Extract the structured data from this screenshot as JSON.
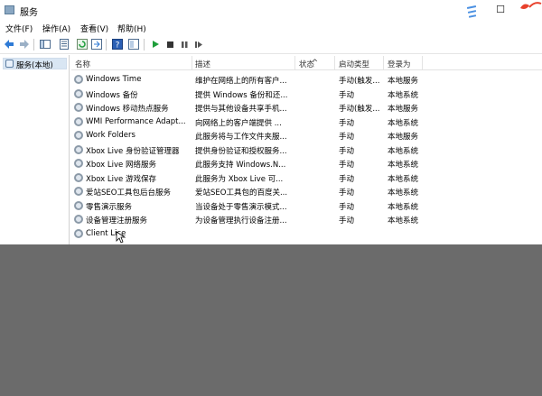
{
  "window": {
    "title": "服务"
  },
  "menu": [
    "文件(F)",
    "操作(A)",
    "查看(V)",
    "帮助(H)"
  ],
  "tree": {
    "root_label": "服务(本地)"
  },
  "columns": [
    "名称",
    "描述",
    "状态",
    "启动类型",
    "登录为"
  ],
  "rows": [
    {
      "name": "Windows Time",
      "desc": "维护在网络上的所有客户...",
      "status": "",
      "startup": "手动(触发...",
      "logon": "本地服务"
    },
    {
      "name": "Windows 备份",
      "desc": "提供 Windows 备份和还...",
      "status": "",
      "startup": "手动",
      "logon": "本地系统"
    },
    {
      "name": "Windows 移动热点服务",
      "desc": "提供与其他设备共享手机...",
      "status": "",
      "startup": "手动(触发...",
      "logon": "本地服务"
    },
    {
      "name": "WMI Performance Adapt...",
      "desc": "向网络上的客户端提供 ...",
      "status": "",
      "startup": "手动",
      "logon": "本地系统"
    },
    {
      "name": "Work Folders",
      "desc": "此服务将与工作文件夹服...",
      "status": "",
      "startup": "手动",
      "logon": "本地服务"
    },
    {
      "name": "Xbox Live 身份验证管理器",
      "desc": "提供身份验证和授权服务...",
      "status": "",
      "startup": "手动",
      "logon": "本地系统"
    },
    {
      "name": "Xbox Live 网络服务",
      "desc": "此服务支持 Windows.N...",
      "status": "",
      "startup": "手动",
      "logon": "本地系统"
    },
    {
      "name": "Xbox Live 游戏保存",
      "desc": "此服务为 Xbox Live 可...",
      "status": "",
      "startup": "手动",
      "logon": "本地系统"
    },
    {
      "name": "爱站SEO工具包后台服务",
      "desc": "爱站SEO工具包的百度关...",
      "status": "",
      "startup": "手动",
      "logon": "本地系统"
    },
    {
      "name": "零售演示服务",
      "desc": "当设备处于零售演示模式...",
      "status": "",
      "startup": "手动",
      "logon": "本地系统"
    },
    {
      "name": "设备管理注册服务",
      "desc": "为设备管理执行设备注册...",
      "status": "",
      "startup": "手动",
      "logon": "本地系统"
    },
    {
      "name": "Client Lice",
      "desc": "",
      "status": "",
      "startup": "",
      "logon": ""
    }
  ],
  "colors": {
    "overlay": "#6b6b6b",
    "selection": "#d9e6f3",
    "accent": "#4a90e2",
    "play": "#1e9e3a"
  },
  "icons": [
    "back-icon",
    "forward-icon",
    "console-tree-icon",
    "properties-icon",
    "refresh-icon",
    "export-icon",
    "help-icon",
    "view-icon",
    "start-icon",
    "stop-icon",
    "pause-icon",
    "restart-icon",
    "gear-icon",
    "mouse-cursor-icon"
  ]
}
